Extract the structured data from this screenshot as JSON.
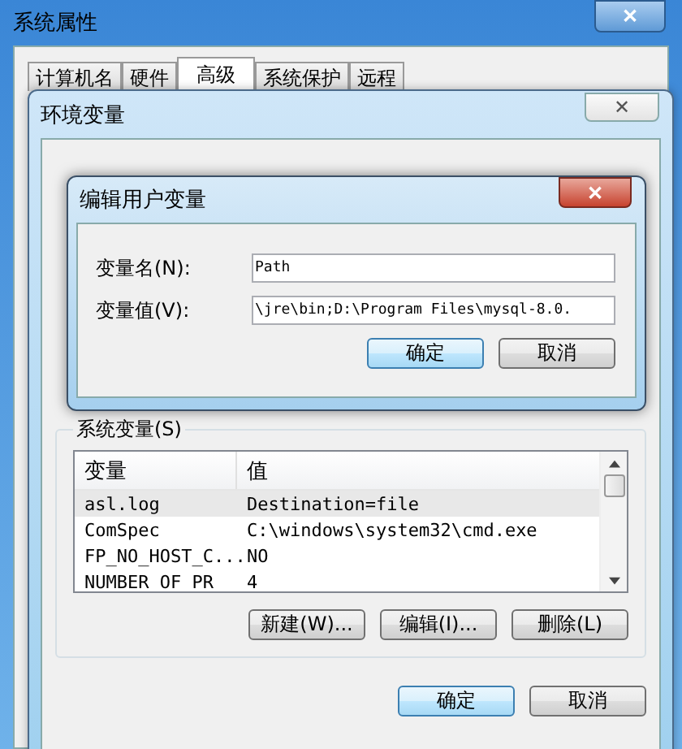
{
  "window": {
    "title": "系统属性",
    "close": "✕"
  },
  "tabs": [
    {
      "label": "计算机名",
      "selected": false
    },
    {
      "label": "硬件",
      "selected": false
    },
    {
      "label": "高级",
      "selected": true
    },
    {
      "label": "系统保护",
      "selected": false
    },
    {
      "label": "远程",
      "selected": false
    }
  ],
  "env_dialog": {
    "title": "环境变量",
    "close": "✕",
    "system_vars": {
      "label": "系统变量(S)",
      "columns": [
        "变量",
        "值"
      ],
      "rows": [
        {
          "name": "asl.log",
          "value": "Destination=file",
          "selected": true
        },
        {
          "name": "ComSpec",
          "value": "C:\\windows\\system32\\cmd.exe",
          "selected": false
        },
        {
          "name": "FP_NO_HOST_C...",
          "value": "NO",
          "selected": false
        },
        {
          "name": "NUMBER_OF_PR",
          "value": "4",
          "selected": false
        }
      ],
      "buttons": [
        "新建(W)...",
        "编辑(I)...",
        "删除(L)"
      ]
    },
    "buttons": [
      "确定",
      "取消"
    ]
  },
  "edit_dialog": {
    "title": "编辑用户变量",
    "close": "✕",
    "fields": [
      {
        "label": "变量名(N):",
        "value": "Path"
      },
      {
        "label": "变量值(V):",
        "value": "\\jre\\bin;D:\\Program Files\\mysql-8.0."
      }
    ],
    "buttons": [
      "确定",
      "取消"
    ]
  }
}
